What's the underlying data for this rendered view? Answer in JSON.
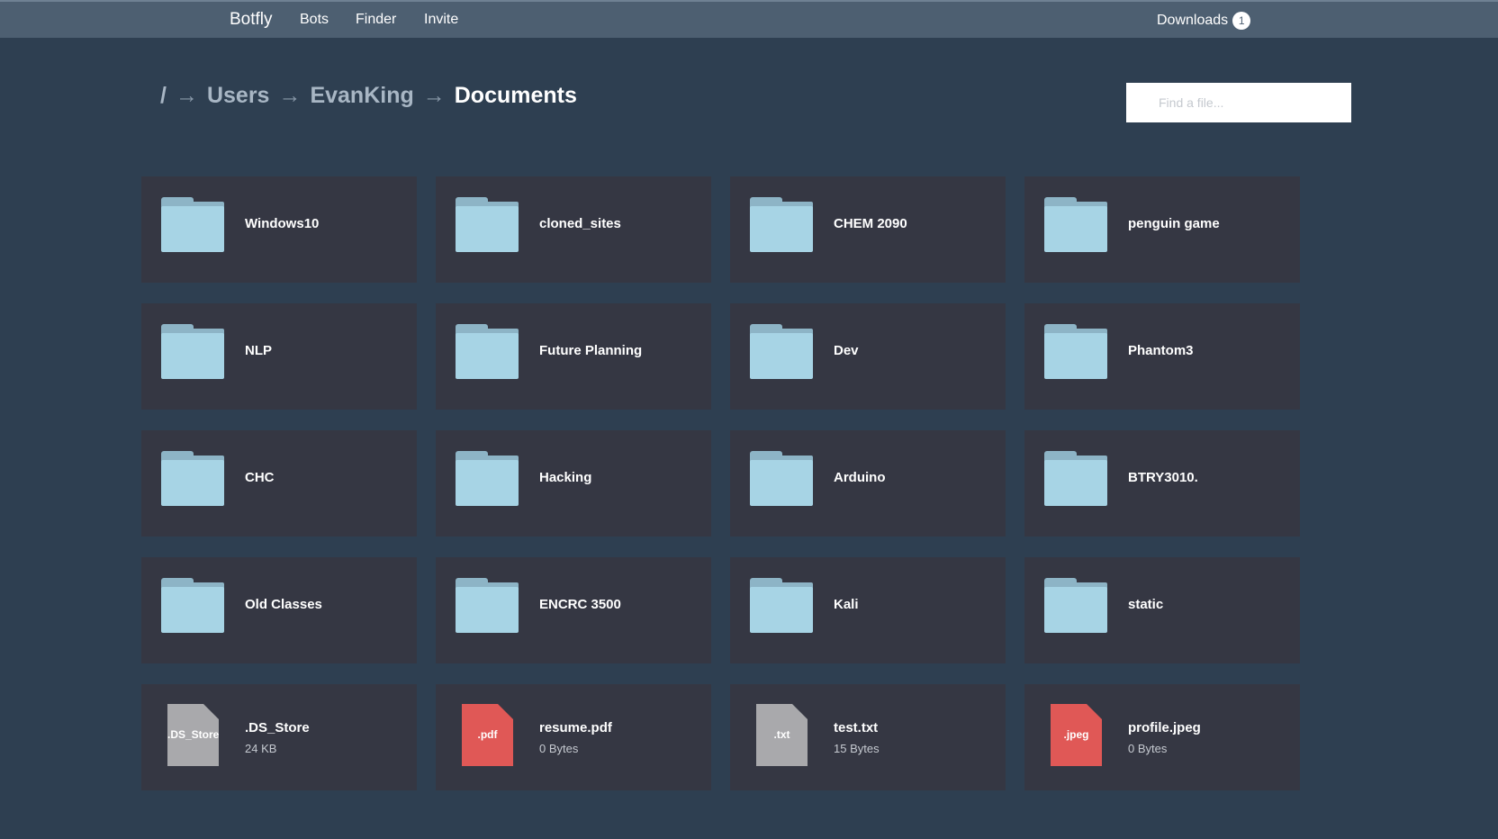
{
  "nav": {
    "brand": "Botfly",
    "links": [
      "Bots",
      "Finder",
      "Invite"
    ],
    "downloads_label": "Downloads",
    "downloads_count": "1"
  },
  "breadcrumb": {
    "root": "/",
    "separator": "→",
    "items": [
      "Users",
      "EvanKing"
    ],
    "current": "Documents"
  },
  "search": {
    "placeholder": "Find a file...",
    "value": ""
  },
  "folders": [
    "Windows10",
    "cloned_sites",
    "CHEM 2090",
    "penguin game",
    "NLP",
    "Future Planning",
    "Dev",
    "Phantom3",
    "CHC",
    "Hacking",
    "Arduino",
    "BTRY3010.",
    "Old Classes",
    "ENCRC 3500",
    "Kali",
    "static"
  ],
  "files": [
    {
      "name": ".DS_Store",
      "ext": ".DS_Store",
      "size": "24 KB",
      "color": "#a9a9ac"
    },
    {
      "name": "resume.pdf",
      "ext": ".pdf",
      "size": "0 Bytes",
      "color": "#e05856"
    },
    {
      "name": "test.txt",
      "ext": ".txt",
      "size": "15 Bytes",
      "color": "#a9a9ac"
    },
    {
      "name": "profile.jpeg",
      "ext": ".jpeg",
      "size": "0 Bytes",
      "color": "#e05856"
    }
  ],
  "colors": {
    "background": "#2e3f51",
    "navbar": "#4d5f71",
    "tile": "#353743",
    "folder": "#a7d4e5",
    "file_gray": "#a9a9ac",
    "file_red": "#e05856"
  }
}
